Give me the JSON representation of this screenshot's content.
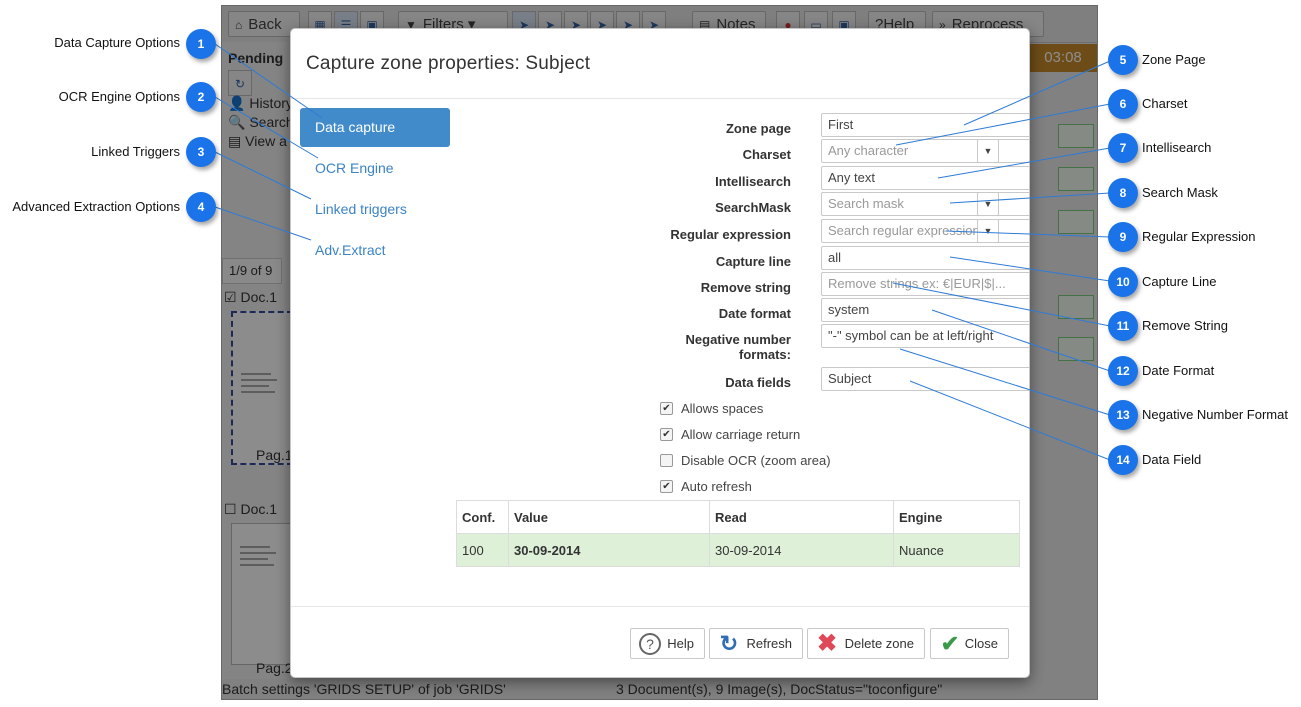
{
  "background_app": {
    "toolbar": {
      "back": "Back",
      "filters": "Filters",
      "notes": "Notes",
      "help": "Help",
      "reprocess": "Reprocess"
    },
    "pending_label": "Pending",
    "history_label": "History",
    "search_label": "Search",
    "view_label": "View a",
    "timer": "03:08",
    "pager": "1/9 of 9",
    "doc1_label": "Doc.1",
    "doc2_label": "Doc.1",
    "page1_label": "Pag.1",
    "page2_label": "Pag.2",
    "status_left": "Batch settings 'GRIDS SETUP' of job 'GRIDS'",
    "status_right": "3 Document(s), 9 Image(s), DocStatus=\"toconfigure\""
  },
  "modal": {
    "title": "Capture zone properties: Subject",
    "nav": [
      {
        "label": "Data capture",
        "active": true
      },
      {
        "label": "OCR Engine",
        "active": false
      },
      {
        "label": "Linked triggers",
        "active": false
      },
      {
        "label": "Adv.Extract",
        "active": false
      }
    ],
    "fields": {
      "zone_page": {
        "label": "Zone page",
        "value": "First"
      },
      "charset": {
        "label": "Charset",
        "placeholder": "Any character"
      },
      "intellisearch": {
        "label": "Intellisearch",
        "value": "Any text"
      },
      "search_mask": {
        "label": "SearchMask",
        "placeholder": "Search mask"
      },
      "regular_expression": {
        "label": "Regular expression",
        "placeholder": "Search regular expression"
      },
      "capture_line": {
        "label": "Capture line",
        "value": "all"
      },
      "remove_string": {
        "label": "Remove string",
        "placeholder": "Remove strings ex: €|EUR|$|..."
      },
      "date_format": {
        "label": "Date format",
        "value": "system"
      },
      "negative_number_formats": {
        "label_line1": "Negative number",
        "label_line2": "formats:",
        "value": "\"-\" symbol can be at left/right"
      },
      "data_fields": {
        "label": "Data fields",
        "value": "Subject"
      }
    },
    "checkboxes": [
      {
        "label": "Allows spaces",
        "checked": true
      },
      {
        "label": "Allow carriage return",
        "checked": true
      },
      {
        "label": "Disable OCR (zoom area)",
        "checked": false
      },
      {
        "label": "Auto refresh",
        "checked": true
      }
    ],
    "table": {
      "headers": [
        "Conf.",
        "Value",
        "Read",
        "Engine"
      ],
      "row": {
        "conf": "100",
        "value": "30-09-2014",
        "read": "30-09-2014",
        "engine": "Nuance"
      }
    },
    "footer": {
      "help": "Help",
      "refresh": "Refresh",
      "delete_zone": "Delete zone",
      "close": "Close"
    }
  },
  "callouts": [
    {
      "num": "1",
      "label": "Data Capture Options"
    },
    {
      "num": "2",
      "label": "OCR Engine Options"
    },
    {
      "num": "3",
      "label": "Linked Triggers"
    },
    {
      "num": "4",
      "label": "Advanced Extraction Options"
    },
    {
      "num": "5",
      "label": "Zone Page"
    },
    {
      "num": "6",
      "label": "Charset"
    },
    {
      "num": "7",
      "label": "Intellisearch"
    },
    {
      "num": "8",
      "label": "Search Mask"
    },
    {
      "num": "9",
      "label": "Regular Expression"
    },
    {
      "num": "10",
      "label": "Capture Line"
    },
    {
      "num": "11",
      "label": "Remove String"
    },
    {
      "num": "12",
      "label": "Date Format"
    },
    {
      "num": "13",
      "label": "Negative Number Format"
    },
    {
      "num": "14",
      "label": "Data Field"
    }
  ],
  "colors": {
    "accent": "#428bca",
    "callout": "#1a73e8",
    "success_row": "#dff0d8"
  }
}
